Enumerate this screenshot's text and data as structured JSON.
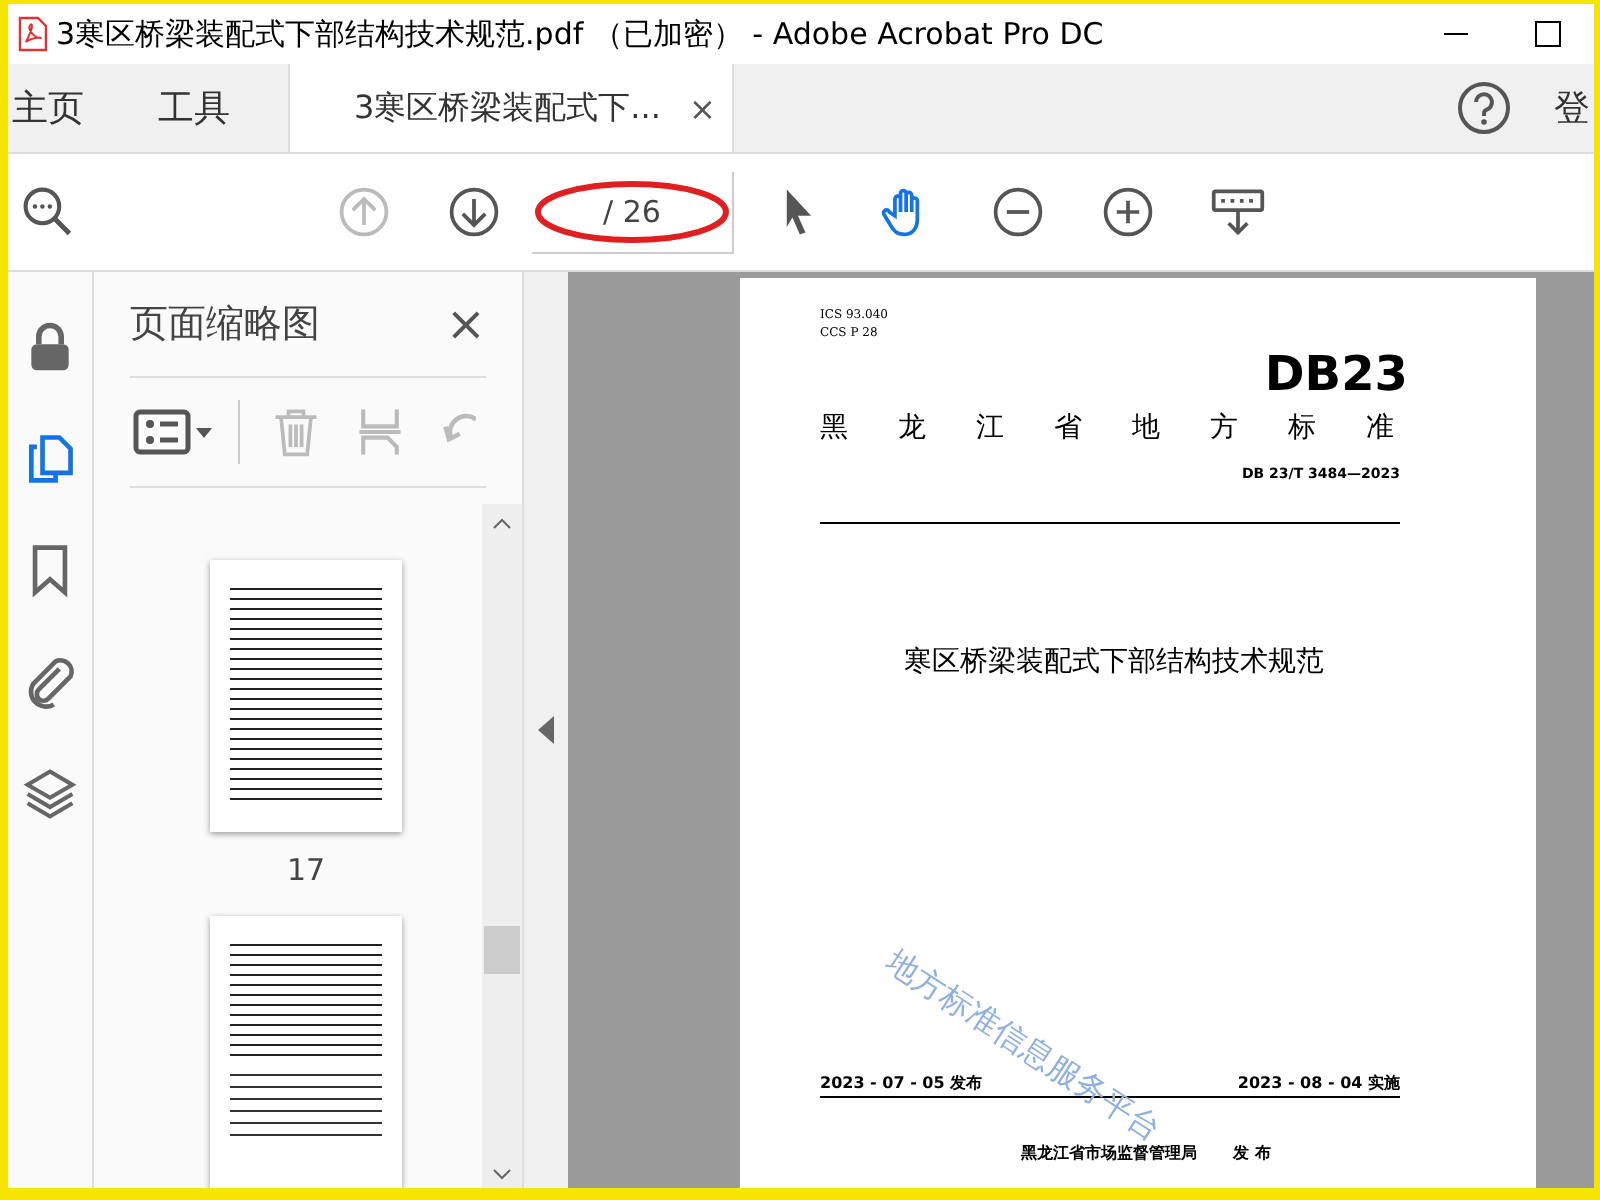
{
  "window": {
    "title": "3寒区桥梁装配式下部结构技术规范.pdf （已加密） - Adobe Acrobat Pro DC"
  },
  "nav_tabs": [
    {
      "label": "主页",
      "selected": false
    },
    {
      "label": "工具",
      "selected": false
    }
  ],
  "document_tab": {
    "label": "3寒区桥梁装配式下...",
    "close": "×",
    "selected": true
  },
  "account": {
    "label": "登"
  },
  "toolbar": {
    "page_total": "/ 26"
  },
  "rail": [
    {
      "kind": "lock",
      "selected": false
    },
    {
      "kind": "pages",
      "selected": true
    },
    {
      "kind": "bookmark",
      "selected": false
    },
    {
      "kind": "attachment",
      "selected": false
    },
    {
      "kind": "layers",
      "selected": false
    }
  ],
  "thumbnails_panel": {
    "title": "页面缩略图",
    "close": "×",
    "thumbnails": [
      {
        "kind": "text",
        "label": "17"
      },
      {
        "kind": "table"
      }
    ]
  },
  "page": {
    "ics": "ICS  93.040",
    "ccs": "CCS  P 28",
    "code": "DB23",
    "org": "黑龙江省地方标准",
    "number": "DB 23/T  3484—2023",
    "title": "寒区桥梁装配式下部结构技术规范",
    "watermark": "地方标准信息服务平台",
    "issued": "2023 - 07 - 05 发布",
    "effective": "2023 - 08 - 04 实施",
    "issuer": "黑龙江省市场监督管理局",
    "issuer_action": "发  布"
  }
}
